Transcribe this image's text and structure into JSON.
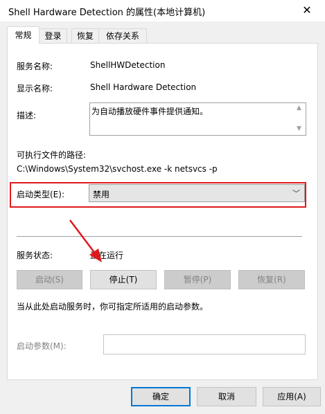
{
  "window": {
    "title": "Shell Hardware Detection 的属性(本地计算机)",
    "close_glyph": "✕"
  },
  "tabs": [
    {
      "label": "常规"
    },
    {
      "label": "登录"
    },
    {
      "label": "恢复"
    },
    {
      "label": "依存关系"
    }
  ],
  "general": {
    "service_name_label": "服务名称:",
    "service_name_value": "ShellHWDetection",
    "display_name_label": "显示名称:",
    "display_name_value": "Shell Hardware Detection",
    "description_label": "描述:",
    "description_value": "为自动播放硬件事件提供通知。",
    "exe_path_label": "可执行文件的路径:",
    "exe_path_value": "C:\\Windows\\System32\\svchost.exe -k netsvcs -p",
    "startup_type_label": "启动类型(E):",
    "startup_type_value": "禁用",
    "status_label": "服务状态:",
    "status_value": "正在运行",
    "buttons": {
      "start": "启动(S)",
      "stop": "停止(T)",
      "pause": "暂停(P)",
      "resume": "恢复(R)"
    },
    "hint": "当从此处启动服务时，你可指定所适用的启动参数。",
    "params_label": "启动参数(M):",
    "params_value": ""
  },
  "footer": {
    "ok": "确定",
    "cancel": "取消",
    "apply": "应用(A)"
  },
  "colors": {
    "highlight": "#e0181e",
    "focus": "#0078d7"
  }
}
